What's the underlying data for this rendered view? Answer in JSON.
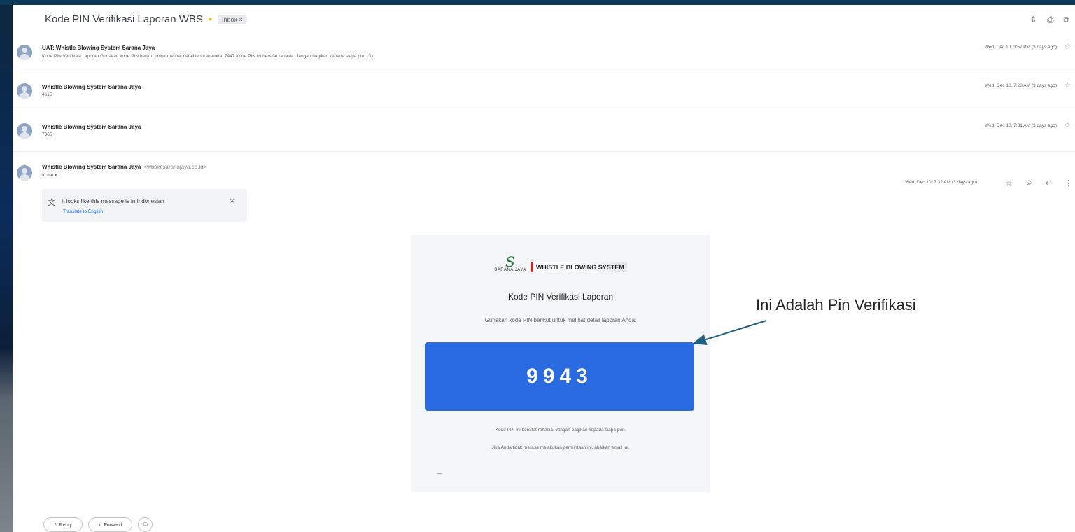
{
  "thread": {
    "subject": "Kode PIN Verifikasi Laporan WBS",
    "label": "Inbox ×"
  },
  "messages": [
    {
      "sender": "UAT: Whistle Blowing System Sarana Jaya",
      "snippet": "Kode PIN Verifikasi Laporan Gunakan kode PIN berikut untuk melihat detail laporan Anda: 7447 Kode PIN ini bersifat rahasia. Jangan bagikan kepada siapa pun. Jik",
      "date": "Wed, Dec 10, 3:57 PM (3 days ago)"
    },
    {
      "sender": "Whistle Blowing System Sarana Jaya",
      "snippet": "4615",
      "date": "Wed, Dec 10, 7:23 AM (3 days ago)"
    },
    {
      "sender": "Whistle Blowing System Sarana Jaya",
      "snippet": "7365",
      "date": "Wed, Dec 10, 7:31 AM (3 days ago)"
    },
    {
      "sender": "Whistle Blowing System Sarana Jaya",
      "sender_email": "<wbs@saranajaya.co.id>",
      "recipient": "to me ▾",
      "date": "Wed, Dec 10, 7:32 AM (3 days ago)"
    }
  ],
  "translate": {
    "text": "It looks like this message is in Indonesian",
    "link": "Translate to English"
  },
  "email": {
    "logo_left": "SARANA JAYA",
    "logo_right": "WHISTLE BLOWING SYSTEM",
    "title": "Kode PIN Verifikasi Laporan",
    "subtitle": "Gunakan kode PIN berikut untuk melihat detail laporan Anda:",
    "pin": "9943",
    "note1": "Kode PIN ini bersifat rahasia. Jangan bagikan kepada siapa pun.",
    "note2": "Jika Anda tidak merasa melakukan permintaan ini, abaikan email ini.",
    "dash": "—"
  },
  "actions": {
    "reply": "↰ Reply",
    "forward": "↱ Forward"
  },
  "annotation": {
    "text": "Ini Adalah Pin Verifikasi",
    "color": "#1f5f7f"
  }
}
